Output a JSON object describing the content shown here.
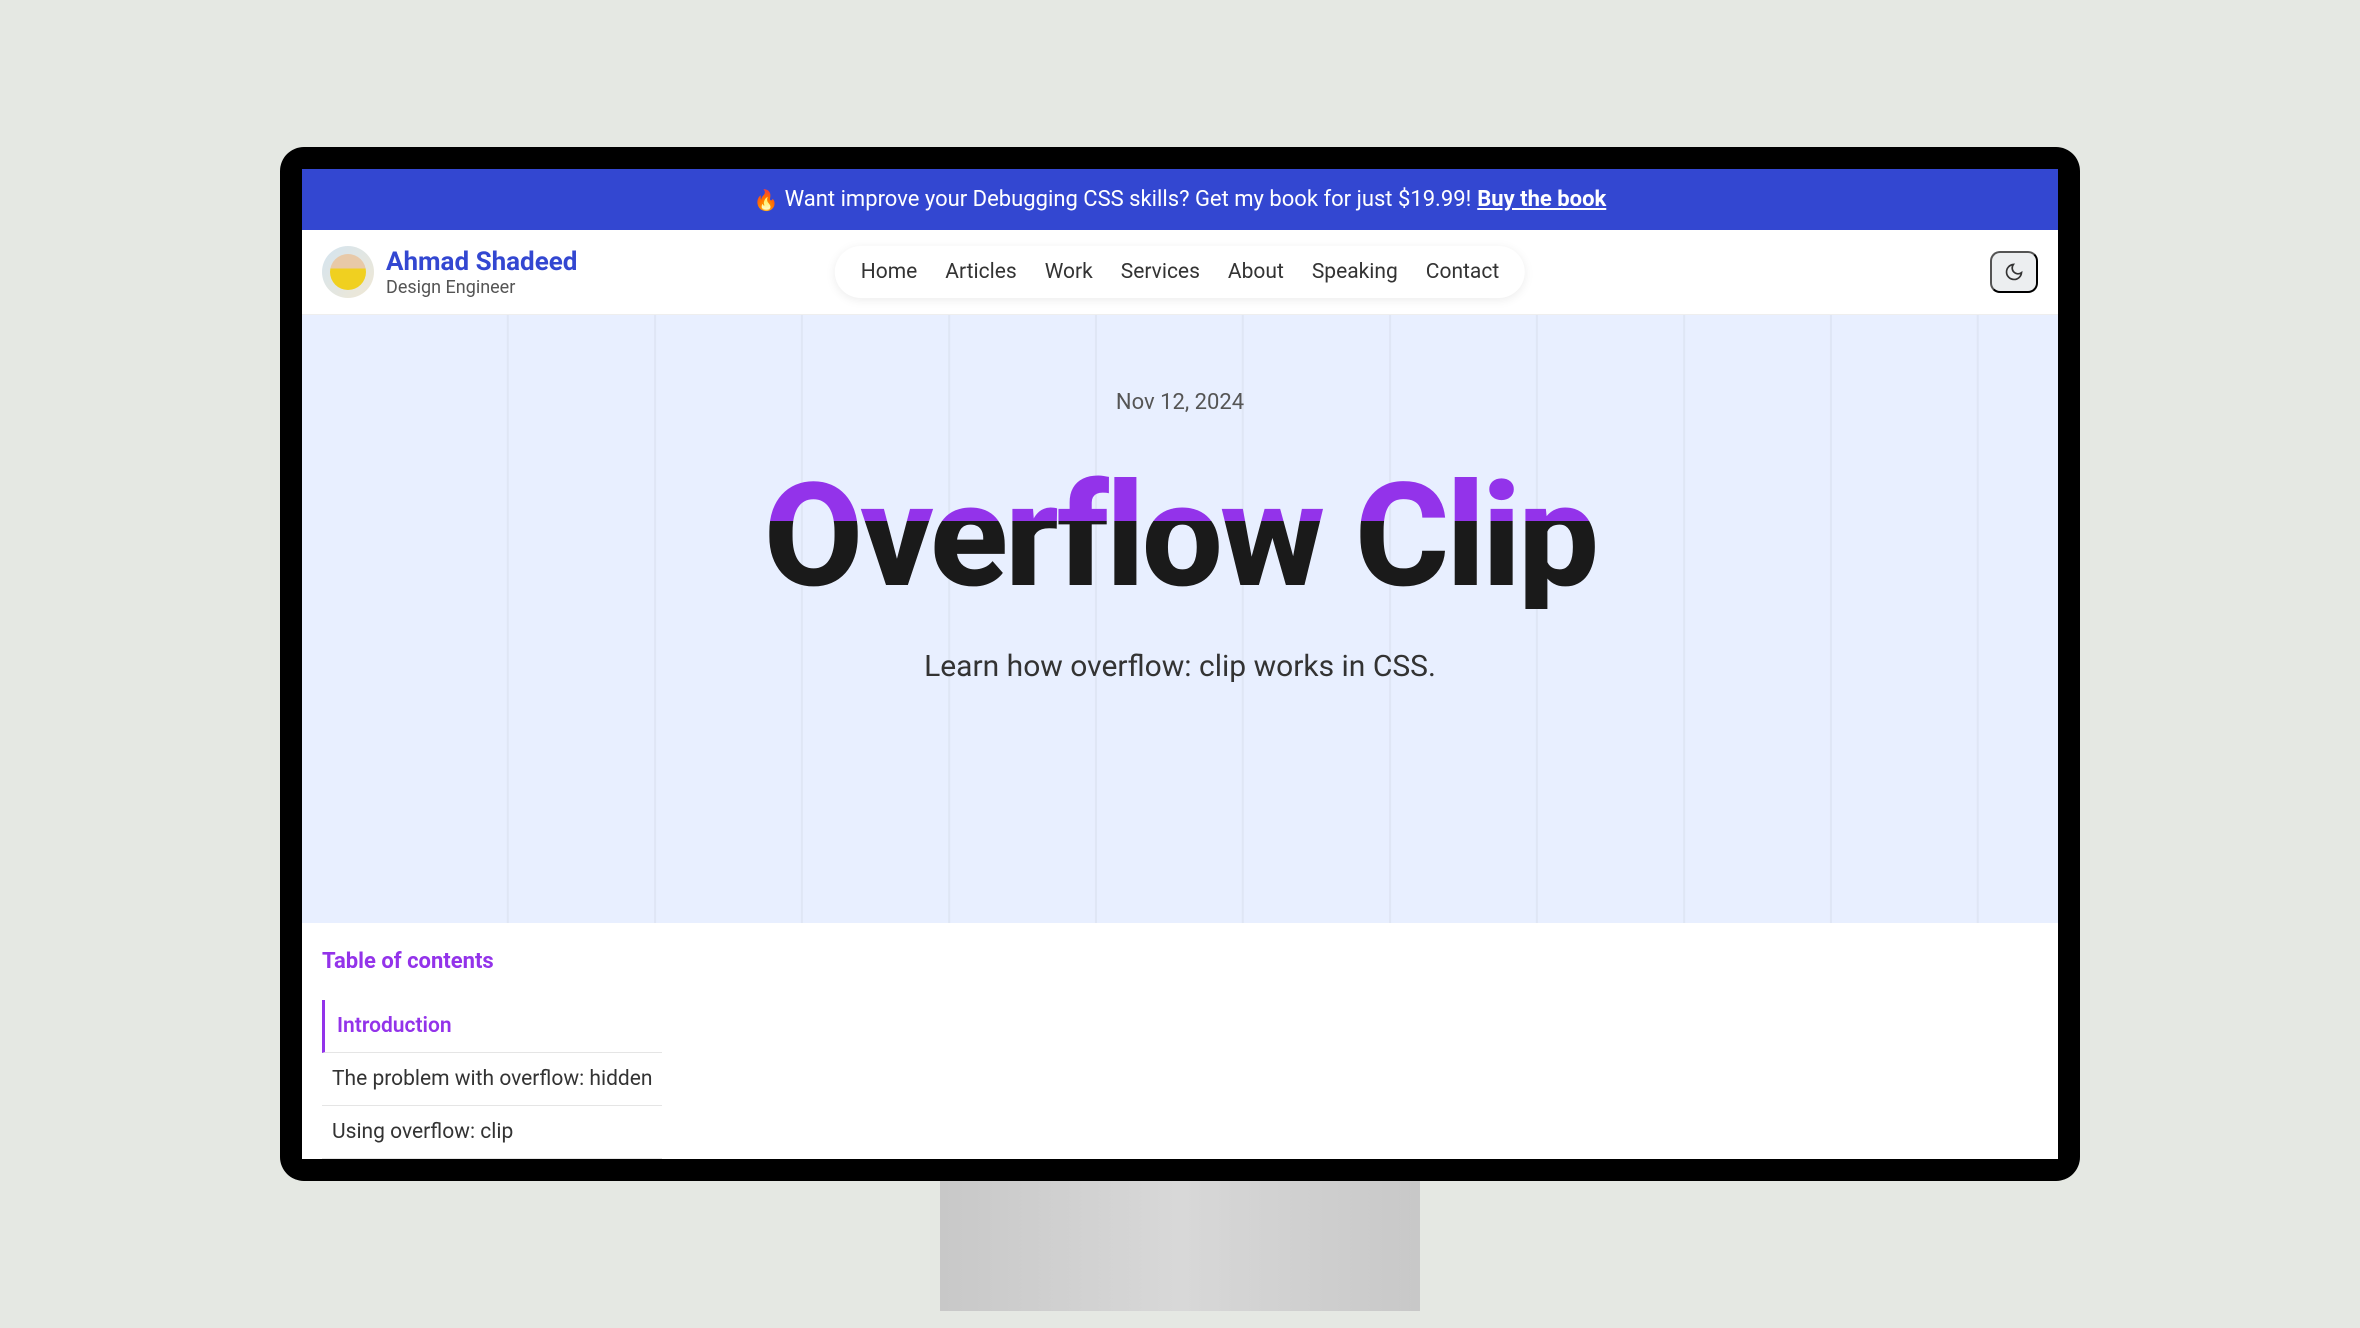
{
  "promo": {
    "emoji": "🔥",
    "text": "Want improve your Debugging CSS skills? Get my book for just $19.99!",
    "cta": "Buy the book"
  },
  "header": {
    "author_name": "Ahmad Shadeed",
    "author_title": "Design Engineer",
    "nav": [
      "Home",
      "Articles",
      "Work",
      "Services",
      "About",
      "Speaking",
      "Contact"
    ]
  },
  "article": {
    "date": "Nov 12, 2024",
    "title": "Overflow Clip",
    "subtitle": "Learn how overflow: clip works in CSS."
  },
  "toc": {
    "heading": "Table of contents",
    "items": [
      {
        "label": "Introduction",
        "active": true
      },
      {
        "label": "The problem with overflow: hidden",
        "active": false
      },
      {
        "label": "Using overflow: clip",
        "active": false
      }
    ]
  }
}
